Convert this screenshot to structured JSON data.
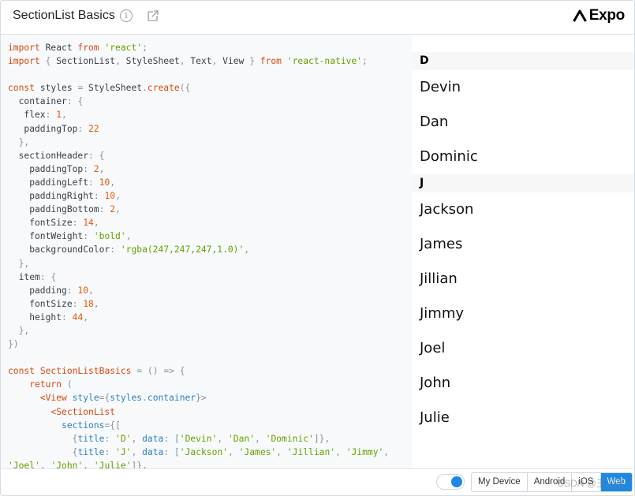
{
  "header": {
    "title": "SectionList Basics",
    "info_icon_glyph": "i",
    "info_icon": "info-icon",
    "popout_icon": "external-link-icon",
    "brand": "Expo"
  },
  "code_lines": [
    "import React from 'react';",
    "import { SectionList, StyleSheet, Text, View } from 'react-native';",
    "",
    "const styles = StyleSheet.create({",
    "  container: {",
    "   flex: 1,",
    "   paddingTop: 22",
    "  },",
    "  sectionHeader: {",
    "    paddingTop: 2,",
    "    paddingLeft: 10,",
    "    paddingRight: 10,",
    "    paddingBottom: 2,",
    "    fontSize: 14,",
    "    fontWeight: 'bold',",
    "    backgroundColor: 'rgba(247,247,247,1.0)',",
    "  },",
    "  item: {",
    "    padding: 10,",
    "    fontSize: 18,",
    "    height: 44,",
    "  },",
    "})",
    "",
    "const SectionListBasics = () => {",
    "    return (",
    "      <View style={styles.container}>",
    "        <SectionList",
    "          sections={[",
    "            {title: 'D', data: ['Devin', 'Dan', 'Dominic']},",
    "            {title: 'J', data: ['Jackson', 'James', 'Jillian', 'Jimmy',",
    "'Joel', 'John', 'Julie']},"
  ],
  "sections": [
    {
      "title": "D",
      "items": [
        "Devin",
        "Dan",
        "Dominic"
      ]
    },
    {
      "title": "J",
      "items": [
        "Jackson",
        "James",
        "Jillian",
        "Jimmy",
        "Joel",
        "John",
        "Julie"
      ]
    }
  ],
  "footer": {
    "toggle_on": true,
    "platforms": [
      "My Device",
      "Android",
      "iOS",
      "Web"
    ],
    "selected_platform": "Web",
    "watermark": "CSDN @玉云逸"
  },
  "colors": {
    "accent": "#1e88e5",
    "keyword": "#d9480f",
    "string": "#68a000",
    "number": "#e8590c",
    "section_header_bg": "#f7f7f7",
    "code_bg": "#f7f9fb"
  }
}
